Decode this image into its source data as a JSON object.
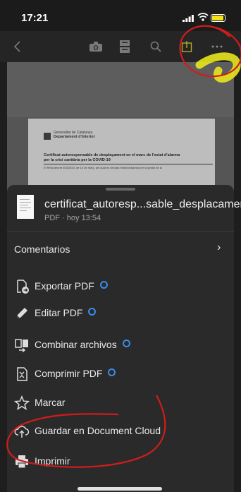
{
  "status_bar": {
    "time": "17:21"
  },
  "document": {
    "org_line_1": "Generalitat de Catalunya",
    "org_line_2": "Departament d'Interior",
    "title_line_1": "Certificat autoresponsable de desplaçament en el marc de l'estat d'alarma",
    "title_line_2": "per la crisi sanitària per la COVID-19",
    "body_snippet": "El Reial decret 463/2020, de 14 de març, pel qual es declara l'estat d'alarma per la gestió de la"
  },
  "sheet": {
    "file_name": "certificat_autoresp...sable_desplacament",
    "file_meta": "PDF  ·  hoy 13:54",
    "comments_label": "Comentarios",
    "items": [
      {
        "label": "Exportar PDF",
        "badge": true,
        "icon": "export-pdf-icon"
      },
      {
        "label": "Editar PDF",
        "badge": true,
        "icon": "pencil-icon"
      },
      {
        "label": "Combinar archivos",
        "badge": true,
        "icon": "combine-icon"
      },
      {
        "label": "Comprimir PDF",
        "badge": true,
        "icon": "compress-icon"
      },
      {
        "label": "Marcar",
        "badge": false,
        "icon": "star-icon"
      },
      {
        "label": "Guardar en Document Cloud",
        "badge": false,
        "icon": "cloud-upload-icon"
      },
      {
        "label": "Imprimir",
        "badge": false,
        "icon": "printer-icon"
      }
    ]
  },
  "colors": {
    "badge": "#3b8ce8",
    "annotation_red": "#d11c1c",
    "highlight_yellow": "#e8e61c"
  }
}
